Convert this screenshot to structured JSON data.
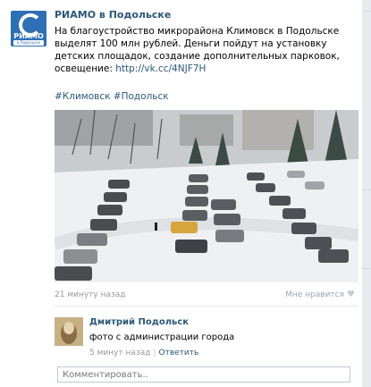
{
  "post": {
    "author": "РИАМО в Подольске",
    "avatar_brand": "РИАМО",
    "avatar_sub": "в Подольске",
    "text": "На благоустройство микрорайона Климовск в Подольске выделят 100 млн рублей. Деньги пойдут на установку детских площадок, создание дополнительных парковок, освещение:",
    "link": "http://vk.cc/4NJF7H",
    "hashtags": "#Климовск #Подольск",
    "time": "21 минуту назад",
    "like_label": "Мне нравится"
  },
  "comment": {
    "author": "Дмитрий Подольск",
    "text": "фото с администрации города",
    "time": "5 минут назад",
    "reply_label": "Ответить"
  },
  "comment_input": {
    "placeholder": "Комментировать.."
  },
  "colors": {
    "link": "#2b587a",
    "meta": "#999999",
    "brand_blue": "#2e6fb5"
  }
}
